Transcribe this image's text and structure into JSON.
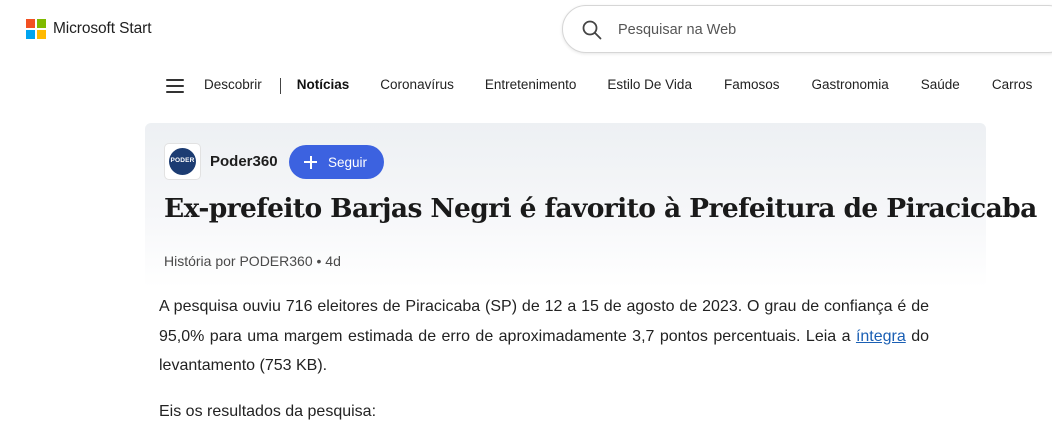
{
  "brand": {
    "name": "Microsoft Start",
    "logo_colors": [
      "#f25022",
      "#7fba00",
      "#00a4ef",
      "#ffb900"
    ]
  },
  "search": {
    "placeholder": "Pesquisar na Web",
    "icon": "search-icon"
  },
  "nav": {
    "menu_icon": "hamburger-menu-icon",
    "items": [
      {
        "label": "Descobrir"
      },
      {
        "label": "Notícias",
        "active": true
      },
      {
        "label": "Coronavírus"
      },
      {
        "label": "Entretenimento"
      },
      {
        "label": "Estilo De Vida"
      },
      {
        "label": "Famosos"
      },
      {
        "label": "Gastronomia"
      },
      {
        "label": "Saúde"
      },
      {
        "label": "Carros"
      }
    ]
  },
  "article": {
    "publisher": {
      "name": "Poder360",
      "logo_text": "PODER",
      "follow_label": "Seguir"
    },
    "headline": "Ex-prefeito Barjas Negri é favorito à Prefeitura de Piracicaba",
    "byline": "História por PODER360 • 4d",
    "paragraph1_before_link": "A pesquisa ouviu 716 eleitores de Piracicaba (SP) de 12 a 15 de agosto de 2023. O grau de confiança é de 95,0% para uma margem estimada de erro de aproximadamente 3,7 pontos percentuais. Leia a ",
    "paragraph1_link": "íntegra",
    "paragraph1_after_link": " do levantamento (753 KB).",
    "paragraph2": "Eis os resultados da pesquisa:"
  },
  "colors": {
    "accent_button": "#3c62e0",
    "link": "#1a5fb4",
    "publisher_logo_bg": "#1c3c72"
  }
}
